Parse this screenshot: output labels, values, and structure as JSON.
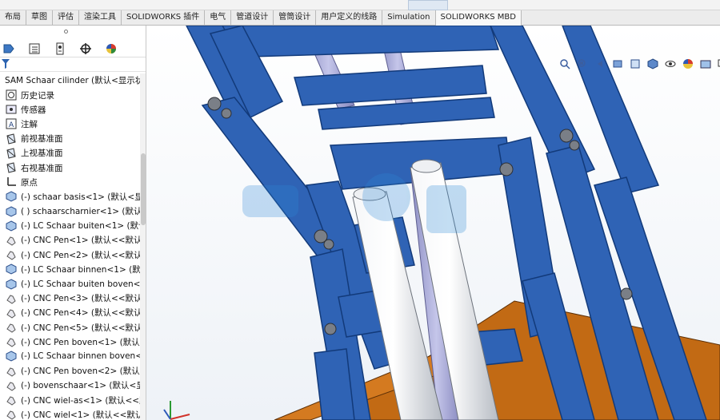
{
  "ribbon": {
    "tabs": [
      "布局",
      "草图",
      "评估",
      "渲染工具",
      "SOLIDWORKS 插件",
      "电气",
      "管道设计",
      "管筒设计",
      "用户定义的线路",
      "Simulation",
      "SOLIDWORKS MBD"
    ]
  },
  "panel": {
    "root_label": "SAM Schaar cilinder  (默认<显示状",
    "items": [
      {
        "label": "历史记录",
        "icon": "history-icon"
      },
      {
        "label": "传感器",
        "icon": "sensor-icon"
      },
      {
        "label": "注解",
        "icon": "annotation-icon"
      },
      {
        "label": "前视基准面",
        "icon": "plane-icon"
      },
      {
        "label": "上视基准面",
        "icon": "plane-icon"
      },
      {
        "label": "右视基准面",
        "icon": "plane-icon"
      },
      {
        "label": "原点",
        "icon": "origin-icon"
      },
      {
        "label": "(-) schaar basis<1> (默认<显示",
        "icon": "part-icon"
      },
      {
        "label": "( ) schaarscharnier<1> (默认<",
        "icon": "part-icon"
      },
      {
        "label": "(-) LC Schaar buiten<1> (默认<",
        "icon": "part-icon"
      },
      {
        "label": "(-) CNC Pen<1> (默认<<默认>",
        "icon": "pen-icon"
      },
      {
        "label": "(-) CNC Pen<2> (默认<<默认>",
        "icon": "pen-icon"
      },
      {
        "label": "(-) LC Schaar binnen<1> (默认<",
        "icon": "part-icon"
      },
      {
        "label": "(-) LC Schaar buiten boven<1>",
        "icon": "part-icon"
      },
      {
        "label": "(-) CNC Pen<3> (默认<<默认>",
        "icon": "pen-icon"
      },
      {
        "label": "(-) CNC Pen<4> (默认<<默认>",
        "icon": "pen-icon"
      },
      {
        "label": "(-) CNC Pen<5> (默认<<默认>",
        "icon": "pen-icon"
      },
      {
        "label": "(-) CNC Pen boven<1> (默认<",
        "icon": "pen-icon"
      },
      {
        "label": "(-) LC Schaar binnen boven<1",
        "icon": "part-icon"
      },
      {
        "label": "(-) CNC Pen boven<2> (默认<",
        "icon": "pen-icon"
      },
      {
        "label": "(-) bovenschaar<1> (默认<显示",
        "icon": "pen-icon"
      },
      {
        "label": "(-) CNC wiel-as<1> (默认<<默",
        "icon": "pen-icon"
      },
      {
        "label": "(-) CNC wiel<1> (默认<<默认",
        "icon": "pen-icon"
      }
    ]
  },
  "colors": {
    "frame_blue": "#2f63b5",
    "frame_edge": "#123a7a",
    "base_orange": "#c26a14",
    "cylinder_gray": "#d9dde3",
    "rod_lilac": "#a6a8d6"
  }
}
